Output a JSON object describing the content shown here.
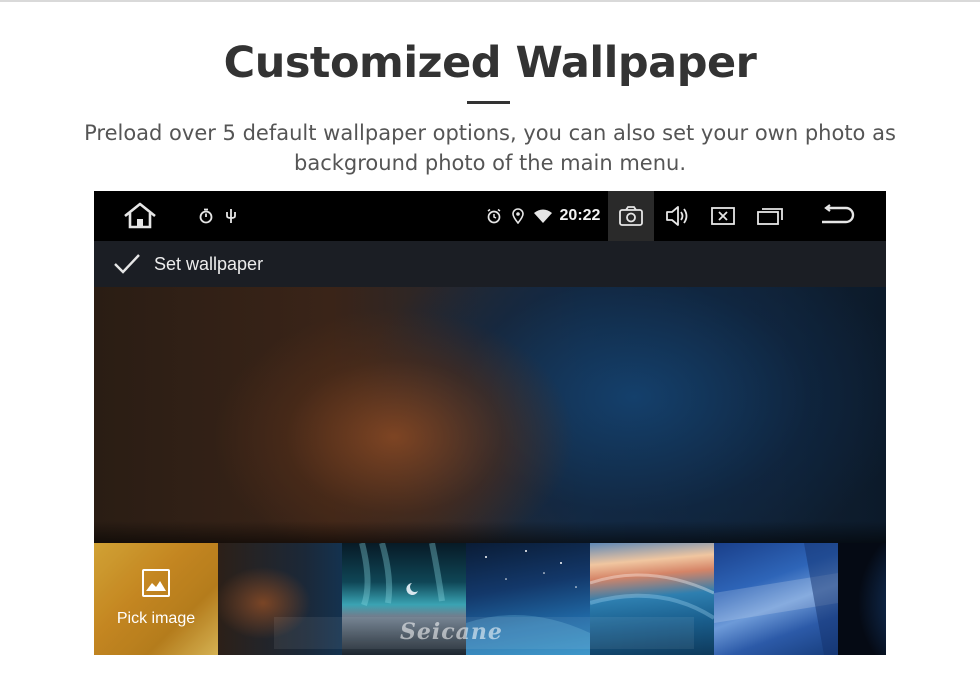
{
  "page": {
    "title": "Customized Wallpaper",
    "subtitle": "Preload over 5 default wallpaper options, you can also set your own photo as background photo of the main menu."
  },
  "statusbar": {
    "time": "20:22",
    "left_icons": [
      "home-icon",
      "timer-icon",
      "usb-icon"
    ],
    "status_icons": [
      "alarm-icon",
      "location-icon",
      "wifi-icon"
    ],
    "right_icons": [
      "camera-icon",
      "volume-icon",
      "close-window-icon",
      "recent-apps-icon",
      "back-icon"
    ]
  },
  "actionbar": {
    "confirm_label": "Set wallpaper",
    "confirm_icon": "checkmark-icon"
  },
  "thumbnails": {
    "pick_label": "Pick image",
    "pick_icon": "image-icon",
    "count": 7
  },
  "watermark": "Seicane",
  "colors": {
    "heading": "#333333",
    "subtitle": "#555555",
    "statusbar_bg": "#000000",
    "actionbar_bg": "#1b1e24"
  }
}
